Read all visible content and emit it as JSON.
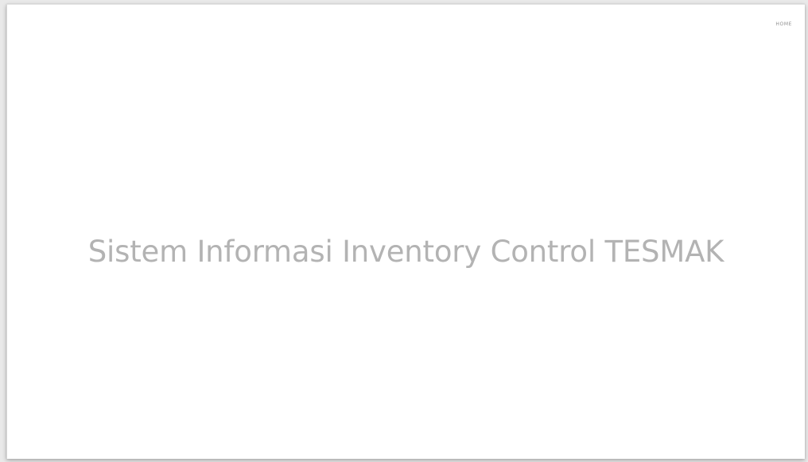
{
  "nav": {
    "home_label": "HOME"
  },
  "hero": {
    "title": "Sistem Informasi Inventory Control TESMAK"
  },
  "colors": {
    "background": "#ffffff",
    "title_text": "#b3b3b3",
    "nav_text": "#8f8f8f"
  }
}
